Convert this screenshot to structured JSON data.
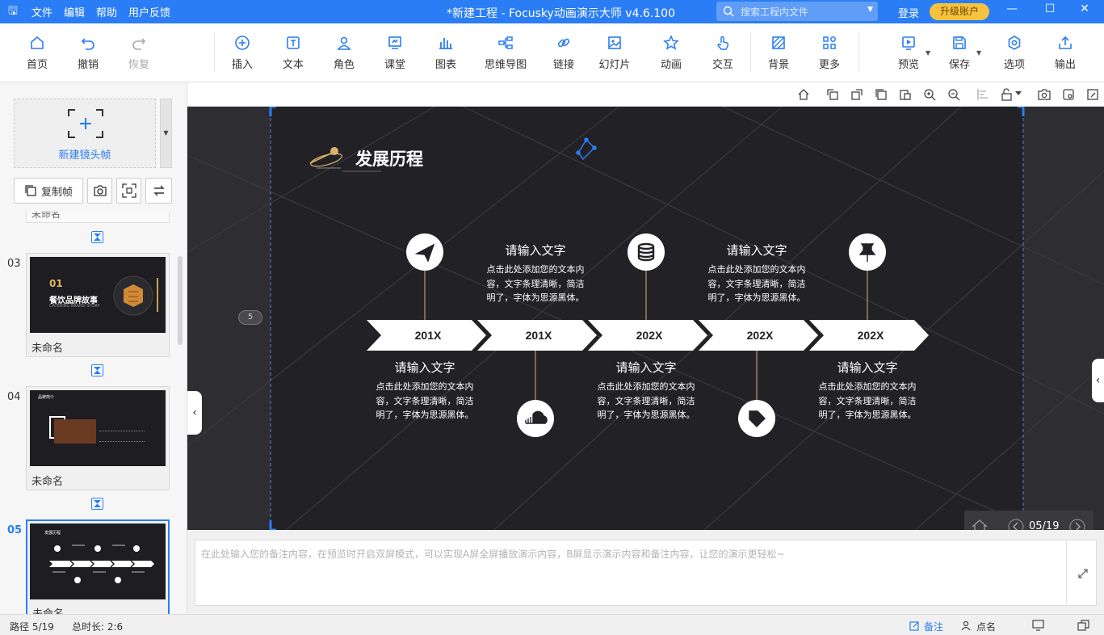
{
  "titlebar": {
    "logo": "🖫",
    "menu": [
      "文件",
      "编辑",
      "帮助",
      "用户反馈"
    ],
    "title": "*新建工程 - Focusky动画演示大师  v4.6.100",
    "search_placeholder": "搜索工程内文件",
    "login": "登录",
    "upgrade": "升级账户"
  },
  "toolbar": {
    "home": "首页",
    "undo": "撤销",
    "redo": "恢复",
    "insert": "插入",
    "text": "文本",
    "role": "角色",
    "class": "课堂",
    "chart": "图表",
    "mindmap": "思维导图",
    "link": "链接",
    "slide": "幻灯片",
    "animation": "动画",
    "interact": "交互",
    "background": "背景",
    "more": "更多",
    "preview": "预览",
    "save": "保存",
    "options": "选项",
    "export": "输出"
  },
  "sidebar": {
    "new_frame": "新建镜头帧",
    "copy_frame": "复制帧",
    "prev_name": "未命名",
    "slides": [
      {
        "num": "03",
        "name": "未命名",
        "thumb_title_num": "01",
        "thumb_title": "餐饮品牌故事",
        "thumb_sub": "CATERING BRAND STORY"
      },
      {
        "num": "04",
        "name": "未命名",
        "thumb_title": "品牌简介"
      },
      {
        "num": "05",
        "name": "未命名",
        "thumb_title": "发展历程",
        "active": true
      }
    ]
  },
  "slide": {
    "title": "发展历程",
    "frame_badge": "5",
    "timeline": [
      {
        "year": "201X",
        "heading": "请输入文字",
        "body": [
          "点击此处添加您的文本内",
          "容，文字条理清晰，简洁",
          "明了，字体为思源黑体。"
        ],
        "icon": "paper-plane-icon",
        "position": "bottom"
      },
      {
        "year": "201X",
        "heading": "请输入文字",
        "body": [
          "点击此处添加您的文本内",
          "容，文字条理清晰，简洁",
          "明了，字体为思源黑体。"
        ],
        "icon": "soundcloud-icon",
        "position": "top"
      },
      {
        "year": "202X",
        "heading": "请输入文字",
        "body": [
          "点击此处添加您的文本内",
          "容，文字条理清晰，简洁",
          "明了，字体为思源黑体。"
        ],
        "icon": "database-icon",
        "position": "bottom"
      },
      {
        "year": "202X",
        "heading": "请输入文字",
        "body": [
          "点击此处添加您的文本内",
          "容，文字条理清晰，简洁",
          "明了，字体为思源黑体。"
        ],
        "icon": "tag-icon",
        "position": "top"
      },
      {
        "year": "202X",
        "heading": "请输入文字",
        "body": [
          "点击此处添加您的文本内",
          "容，文字条理清晰，简洁",
          "明了，字体为思源黑体。"
        ],
        "icon": "pushpin-icon",
        "position": "bottom"
      }
    ]
  },
  "nav": {
    "page": "05/19"
  },
  "notes": {
    "placeholder": "在此处输入您的备注内容，在预览时开启双屏模式，可以实现A屏全屏播放演示内容，B屏显示演示内容和备注内容，让您的演示更轻松~"
  },
  "status": {
    "path": "路径 5/19",
    "duration": "总时长: 2:6",
    "notes": "备注",
    "rollcall": "点名"
  },
  "colors": {
    "accent": "#2a7df4",
    "upgrade": "#f7c23e",
    "slide_bg": "#222126",
    "workspace": "#2e2d32"
  }
}
